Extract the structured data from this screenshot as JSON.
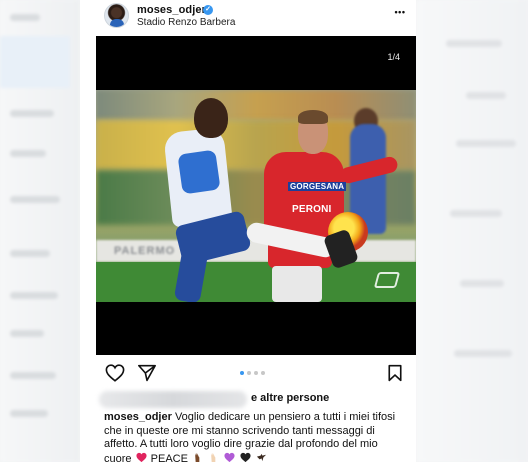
{
  "post": {
    "username": "moses_odjer",
    "verified_mark": "✓",
    "location": "Stadio Renzo Barbera",
    "more_label": "•••",
    "media": {
      "counter": "1/4",
      "sponsor_top": "GORGESANA",
      "sponsor_bottom": "PERONI",
      "board_text": "PALERMO",
      "carousel_count": 4,
      "carousel_active": 0
    },
    "actions": {
      "like_icon": "heart-icon",
      "share_icon": "send-icon",
      "save_icon": "bookmark-icon"
    },
    "likes_suffix": "e altre persone",
    "caption": {
      "user": "moses_odjer",
      "line1": "Voglio dedicare un pensiero a tutti i miei tifosi",
      "line2": "che in queste ore mi stanno scrivendo tanti messaggi di",
      "line3": "affetto. A tutti loro voglio dire grazie dal profondo del mio",
      "line4_word1": "cuore",
      "line4_word2": "PEACE"
    }
  },
  "colors": {
    "accent": "#3897f0",
    "heart": "#e0245e"
  }
}
